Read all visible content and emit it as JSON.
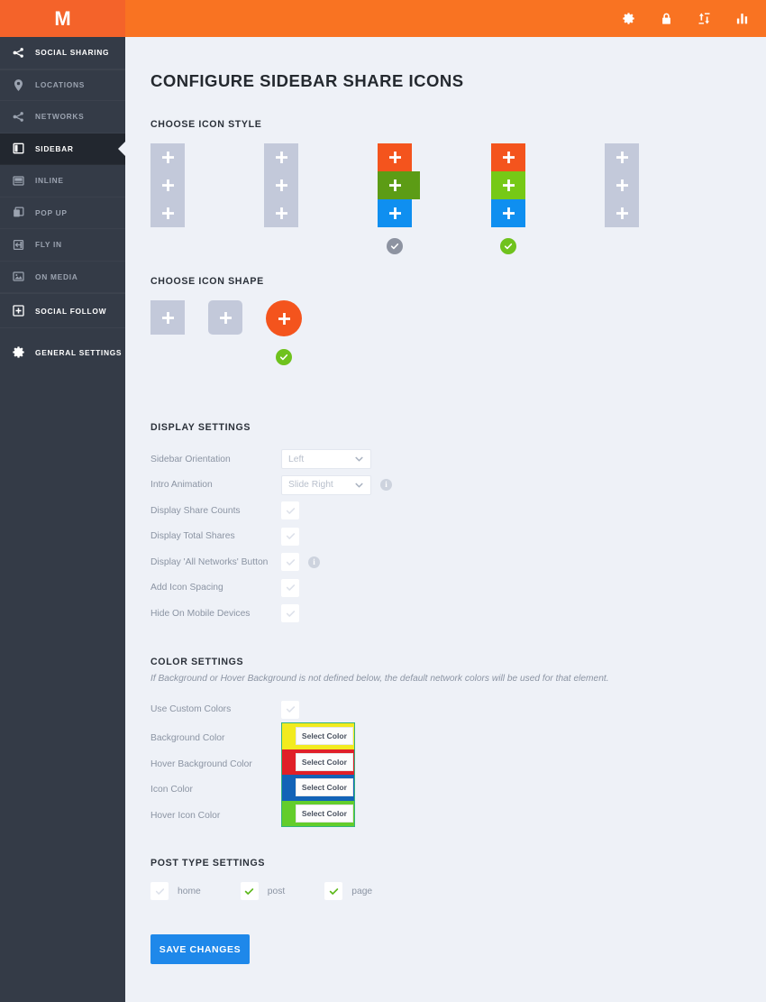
{
  "topbar": {
    "logo": "M",
    "logo_alt": "mashshare-logo",
    "icons": [
      {
        "name": "gear-icon",
        "label": "Settings"
      },
      {
        "name": "lock-icon",
        "label": "Licenses"
      },
      {
        "name": "import-export-icon",
        "label": "Import / Export"
      },
      {
        "name": "analytics-icon",
        "label": "Analytics"
      }
    ]
  },
  "sidebar": {
    "items": [
      {
        "label": "SOCIAL SHARING",
        "icon": "share-icon",
        "state": "header"
      },
      {
        "label": "LOCATIONS",
        "icon": "location-pin-icon",
        "state": "normal"
      },
      {
        "label": "NETWORKS",
        "icon": "share-icon",
        "state": "normal"
      },
      {
        "label": "SIDEBAR",
        "icon": "sidebar-icon",
        "state": "active"
      },
      {
        "label": "INLINE",
        "icon": "inline-icon",
        "state": "normal"
      },
      {
        "label": "POP UP",
        "icon": "popup-icon",
        "state": "normal"
      },
      {
        "label": "FLY IN",
        "icon": "flyin-icon",
        "state": "normal"
      },
      {
        "label": "ON MEDIA",
        "icon": "media-icon",
        "state": "normal"
      },
      {
        "label": "SOCIAL FOLLOW",
        "icon": "plus-square-icon",
        "state": "header"
      },
      {
        "label": "GENERAL SETTINGS",
        "icon": "gear-icon",
        "state": "header"
      }
    ]
  },
  "main": {
    "page_title": "CONFIGURE SIDEBAR SHARE ICONS",
    "icon_style": {
      "title": "CHOOSE ICON STYLE",
      "options": [
        {
          "id": "style-1",
          "state": "inactive",
          "variant": "grey"
        },
        {
          "id": "style-2",
          "state": "inactive",
          "variant": "grey"
        },
        {
          "id": "style-3",
          "state": "hover",
          "variant": "color",
          "badge": "grey-check"
        },
        {
          "id": "style-4",
          "state": "selected",
          "variant": "color",
          "badge": "green-check"
        },
        {
          "id": "style-5",
          "state": "inactive",
          "variant": "grey"
        }
      ],
      "colors": {
        "orange": "#f4541d",
        "green": "#76c916",
        "blue": "#0f8ff0",
        "green_hover": "#5c9c15",
        "grey": "#c3c9da"
      }
    },
    "icon_shape": {
      "title": "CHOOSE ICON SHAPE",
      "options": [
        {
          "id": "shape-square",
          "shape": "square",
          "state": "inactive"
        },
        {
          "id": "shape-rounded",
          "shape": "rounded",
          "state": "inactive"
        },
        {
          "id": "shape-circle",
          "shape": "circle",
          "state": "selected",
          "badge": "green-check"
        }
      ]
    },
    "display_settings": {
      "title": "DISPLAY SETTINGS",
      "rows": [
        {
          "label": "Sidebar Orientation",
          "control": "select",
          "value": "Left",
          "info": false
        },
        {
          "label": "Intro Animation",
          "control": "select",
          "value": "Slide Right",
          "info": true
        },
        {
          "label": "Display Share Counts",
          "control": "checkbox",
          "checked": false,
          "info": false
        },
        {
          "label": "Display Total Shares",
          "control": "checkbox",
          "checked": false,
          "info": false
        },
        {
          "label": "Display 'All Networks' Button",
          "control": "checkbox",
          "checked": false,
          "info": true
        },
        {
          "label": "Add Icon Spacing",
          "control": "checkbox",
          "checked": false,
          "info": false
        },
        {
          "label": "Hide On Mobile Devices",
          "control": "checkbox",
          "checked": false,
          "info": false
        }
      ]
    },
    "color_settings": {
      "title": "COLOR SETTINGS",
      "description": "If Background or Hover Background is not defined below, the default network colors will be used for that element.",
      "custom_colors": {
        "label": "Use Custom Colors",
        "checked": false
      },
      "rows": [
        {
          "label": "Background Color",
          "swatch": "#f2eb1e",
          "button": "Select Color"
        },
        {
          "label": "Hover Background Color",
          "swatch": "#e02027",
          "button": "Select Color"
        },
        {
          "label": "Icon Color",
          "swatch": "#1263b7",
          "button": "Select Color"
        },
        {
          "label": "Hover Icon Color",
          "swatch": "#63cd2b",
          "button": "Select Color"
        }
      ],
      "group_border": "#34b37e"
    },
    "post_type_settings": {
      "title": "POST TYPE SETTINGS",
      "items": [
        {
          "label": "home",
          "checked": false
        },
        {
          "label": "post",
          "checked": true
        },
        {
          "label": "page",
          "checked": true
        }
      ]
    },
    "save_button": "SAVE CHANGES"
  }
}
